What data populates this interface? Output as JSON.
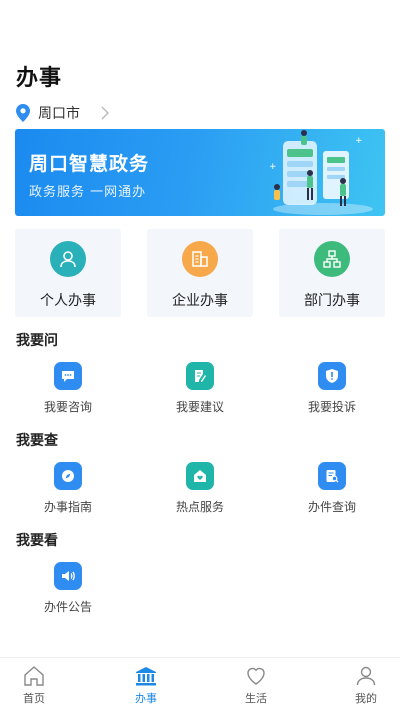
{
  "header": {
    "title": "办事"
  },
  "location": {
    "city": "周口市"
  },
  "banner": {
    "title": "周口智慧政务",
    "subtitle": "政务服务 一网通办"
  },
  "cards": [
    {
      "label": "个人办事",
      "icon": "person-icon",
      "color": "#2ab0b8"
    },
    {
      "label": "企业办事",
      "icon": "building-icon",
      "color": "#f7a84b"
    },
    {
      "label": "部门办事",
      "icon": "org-chart-icon",
      "color": "#3dbb7c"
    }
  ],
  "sections": {
    "ask": {
      "title": "我要问",
      "items": [
        {
          "label": "我要咨询",
          "icon": "chat-icon"
        },
        {
          "label": "我要建议",
          "icon": "edit-doc-icon"
        },
        {
          "label": "我要投诉",
          "icon": "shield-alert-icon"
        }
      ]
    },
    "query": {
      "title": "我要查",
      "items": [
        {
          "label": "办事指南",
          "icon": "compass-icon"
        },
        {
          "label": "热点服务",
          "icon": "home-heart-icon"
        },
        {
          "label": "办件查询",
          "icon": "doc-search-icon"
        }
      ]
    },
    "view": {
      "title": "我要看",
      "items": [
        {
          "label": "办件公告",
          "icon": "speaker-icon"
        }
      ]
    }
  },
  "tabbar": {
    "active": "办事",
    "accent": "#1e88e5",
    "items": [
      {
        "label": "首页",
        "icon": "home-icon"
      },
      {
        "label": "办事",
        "icon": "government-building-icon"
      },
      {
        "label": "生活",
        "icon": "heart-icon"
      },
      {
        "label": "我的",
        "icon": "user-icon"
      }
    ]
  }
}
